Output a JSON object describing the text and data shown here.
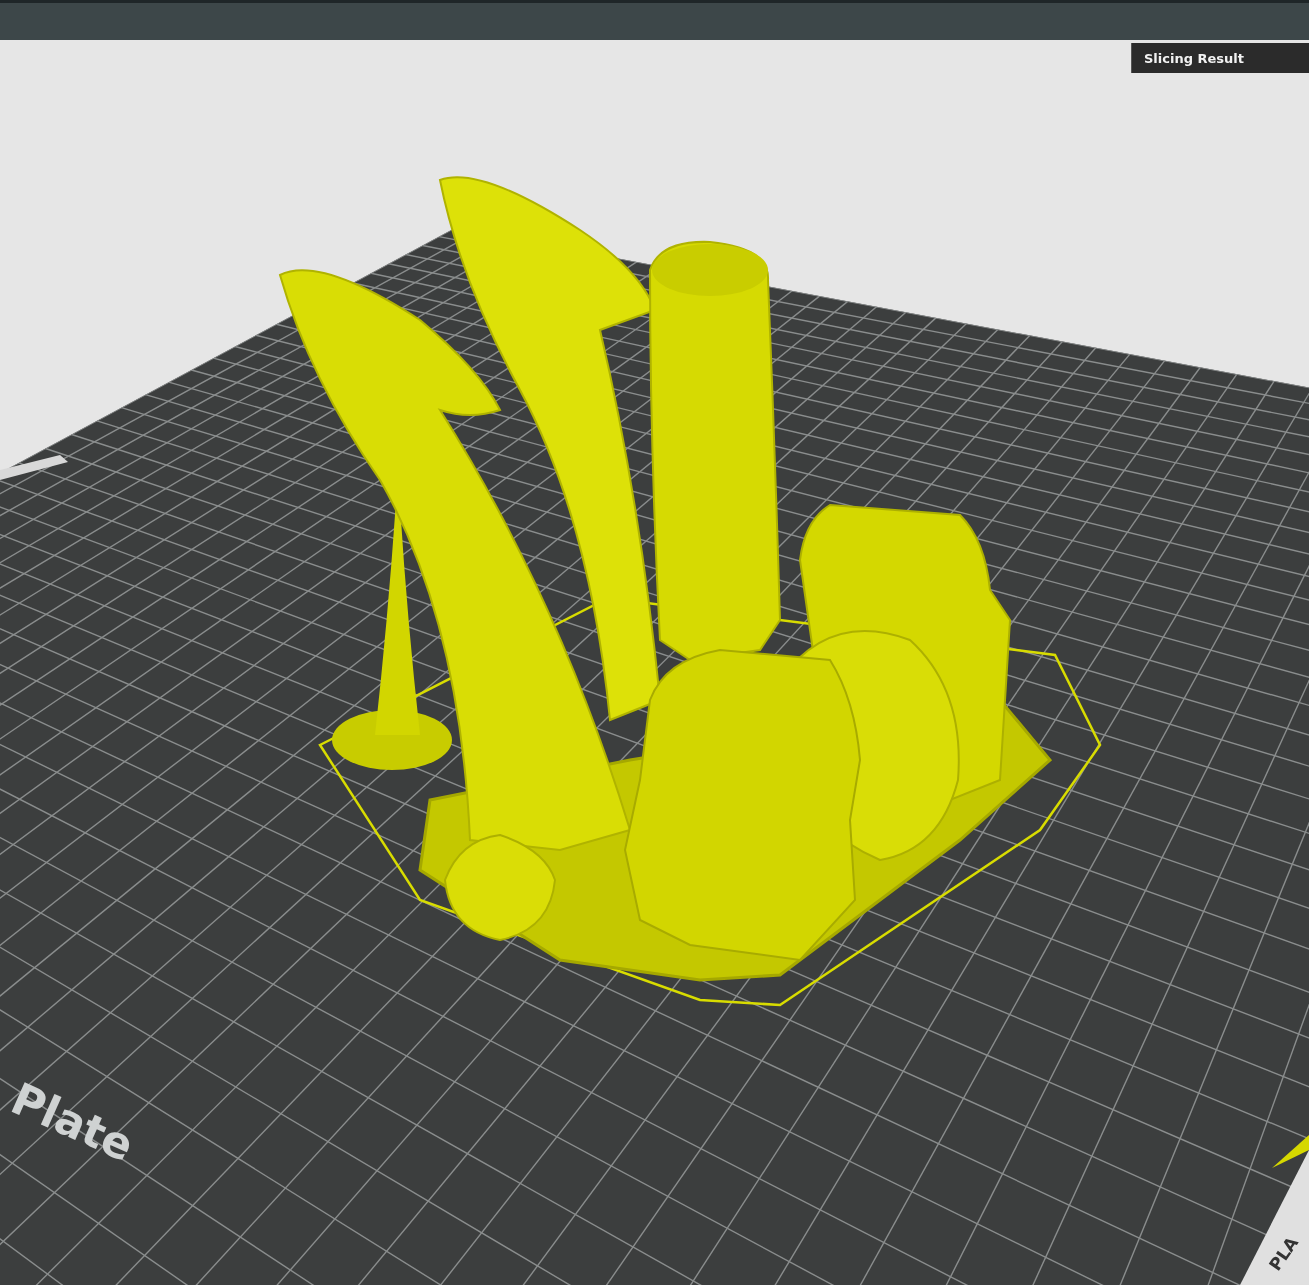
{
  "viewport_tab": {
    "label": "Slicing Result"
  },
  "bed_labels": [
    "Plate",
    "PLA"
  ]
}
